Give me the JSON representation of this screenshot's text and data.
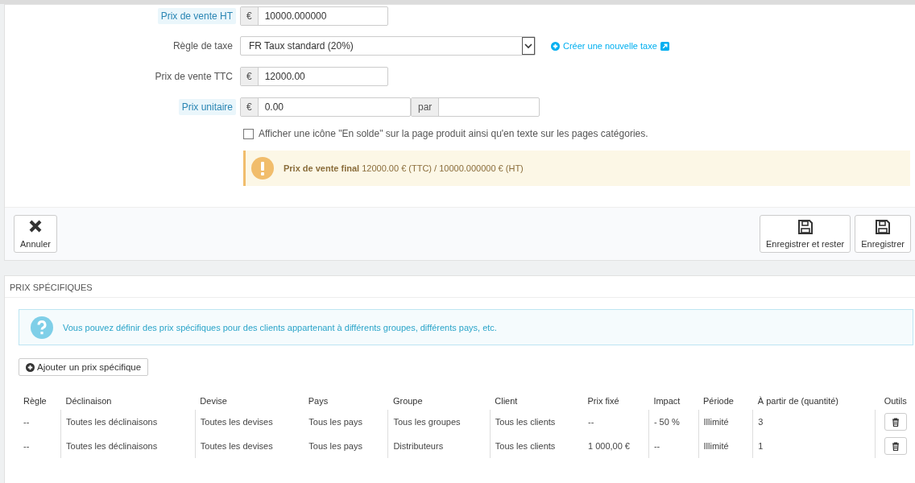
{
  "price_form": {
    "fields": [
      {
        "kind": "addon",
        "label": "Prix de vente HT",
        "hint": true,
        "addon": "€",
        "value": "10000.000000"
      },
      {
        "kind": "select",
        "label": "Règle de taxe",
        "hint": false,
        "value": "FR Taux standard (20%)",
        "link": "Créer une nouvelle taxe"
      },
      {
        "kind": "addon",
        "label": "Prix de vente TTC",
        "hint": false,
        "addon": "€",
        "value": "12000.00"
      },
      {
        "kind": "unit",
        "label": "Prix unitaire",
        "hint": true,
        "addon": "€",
        "value": "0.00",
        "addon2": "par"
      }
    ],
    "on_sale": {
      "label": "Afficher une icône \"En solde\" sur la page produit ainsi qu'en texte sur les pages catégories.",
      "checked": false
    },
    "final_price": "**Prix de vente final** 12000.00 € (TTC) / 10000.000000 € (HT)"
  },
  "footer_buttons": [
    {
      "kind": "cancel",
      "label": "Annuler"
    },
    {
      "kind": "save",
      "label": "Enregistrer et rester"
    },
    {
      "kind": "save",
      "label": "Enregistrer"
    }
  ],
  "specific_prices": {
    "title": "PRIX SPÉCIFIQUES",
    "info": "Vous pouvez définir des prix spécifiques pour des clients appartenant à différents groupes, différents pays, etc.",
    "add_button": "Ajouter un prix spécifique",
    "columns": [
      "Règle",
      "Déclinaison",
      "Devise",
      "Pays",
      "Groupe",
      "Client",
      "Prix fixé",
      "Impact",
      "Période",
      "À partir de (quantité)",
      "Outils"
    ],
    "rows": [
      {
        "cells": [
          "--",
          "Toutes les déclinaisons",
          "Toutes les devises",
          "Tous les pays",
          "Tous les groupes",
          "Tous les clients",
          "--",
          "- 50 %",
          "Illimité",
          "3"
        ]
      },
      {
        "cells": [
          "--",
          "Toutes les déclinaisons",
          "Toutes les devises",
          "Tous les pays",
          "Distributeurs",
          "Tous les clients",
          "1 000,00 €",
          "--",
          "Illimité",
          "1"
        ]
      }
    ]
  }
}
